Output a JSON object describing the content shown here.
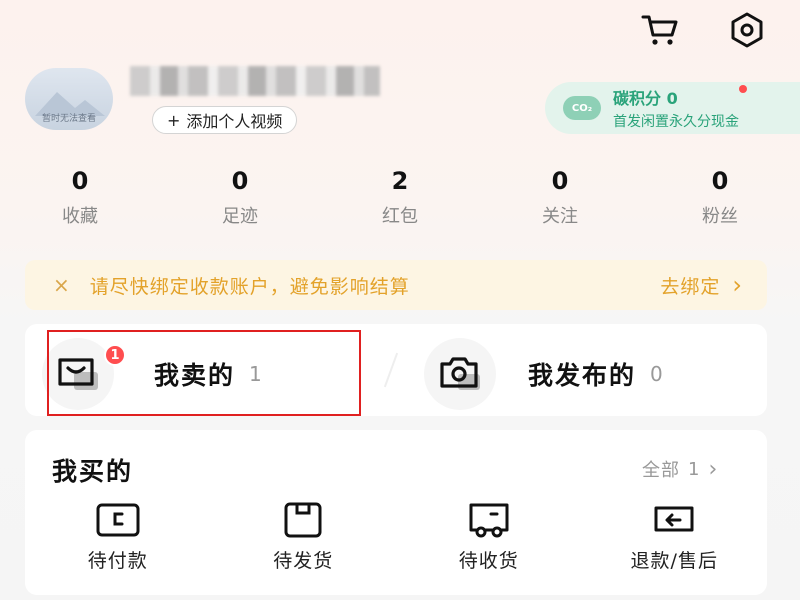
{
  "top_icons": {
    "cart": "cart-icon",
    "settings": "settings-icon"
  },
  "profile": {
    "avatar_caption": "暂时无法查看",
    "add_video_label": "添加个人视频",
    "add_icon": "+"
  },
  "carbon": {
    "badge": "CO₂",
    "title": "碳积分 0",
    "subtitle": "首发闲置永久分现金",
    "colors": {
      "bg": "#e3f3ec",
      "text": "#2aa37a"
    }
  },
  "stats": [
    {
      "value": "0",
      "label": "收藏"
    },
    {
      "value": "0",
      "label": "足迹"
    },
    {
      "value": "2",
      "label": "红包"
    },
    {
      "value": "0",
      "label": "关注"
    },
    {
      "value": "0",
      "label": "粉丝"
    }
  ],
  "notice": {
    "close_icon": "×",
    "message": "请尽快绑定收款账户，避免影响结算",
    "action": "去绑定",
    "chevron": "›",
    "color": "#e3a22a"
  },
  "sell": {
    "label": "我卖的",
    "count": "1",
    "badge": "1"
  },
  "publish": {
    "label": "我发布的",
    "count": "0"
  },
  "buy": {
    "title": "我买的",
    "all_label": "全部",
    "all_count": "1",
    "chevron": "›",
    "orders": [
      {
        "label": "待付款",
        "icon": "wallet-icon"
      },
      {
        "label": "待发货",
        "icon": "box-icon"
      },
      {
        "label": "待收货",
        "icon": "truck-icon"
      },
      {
        "label": "退款/售后",
        "icon": "refund-icon"
      }
    ]
  },
  "highlight_color": "#e02020"
}
